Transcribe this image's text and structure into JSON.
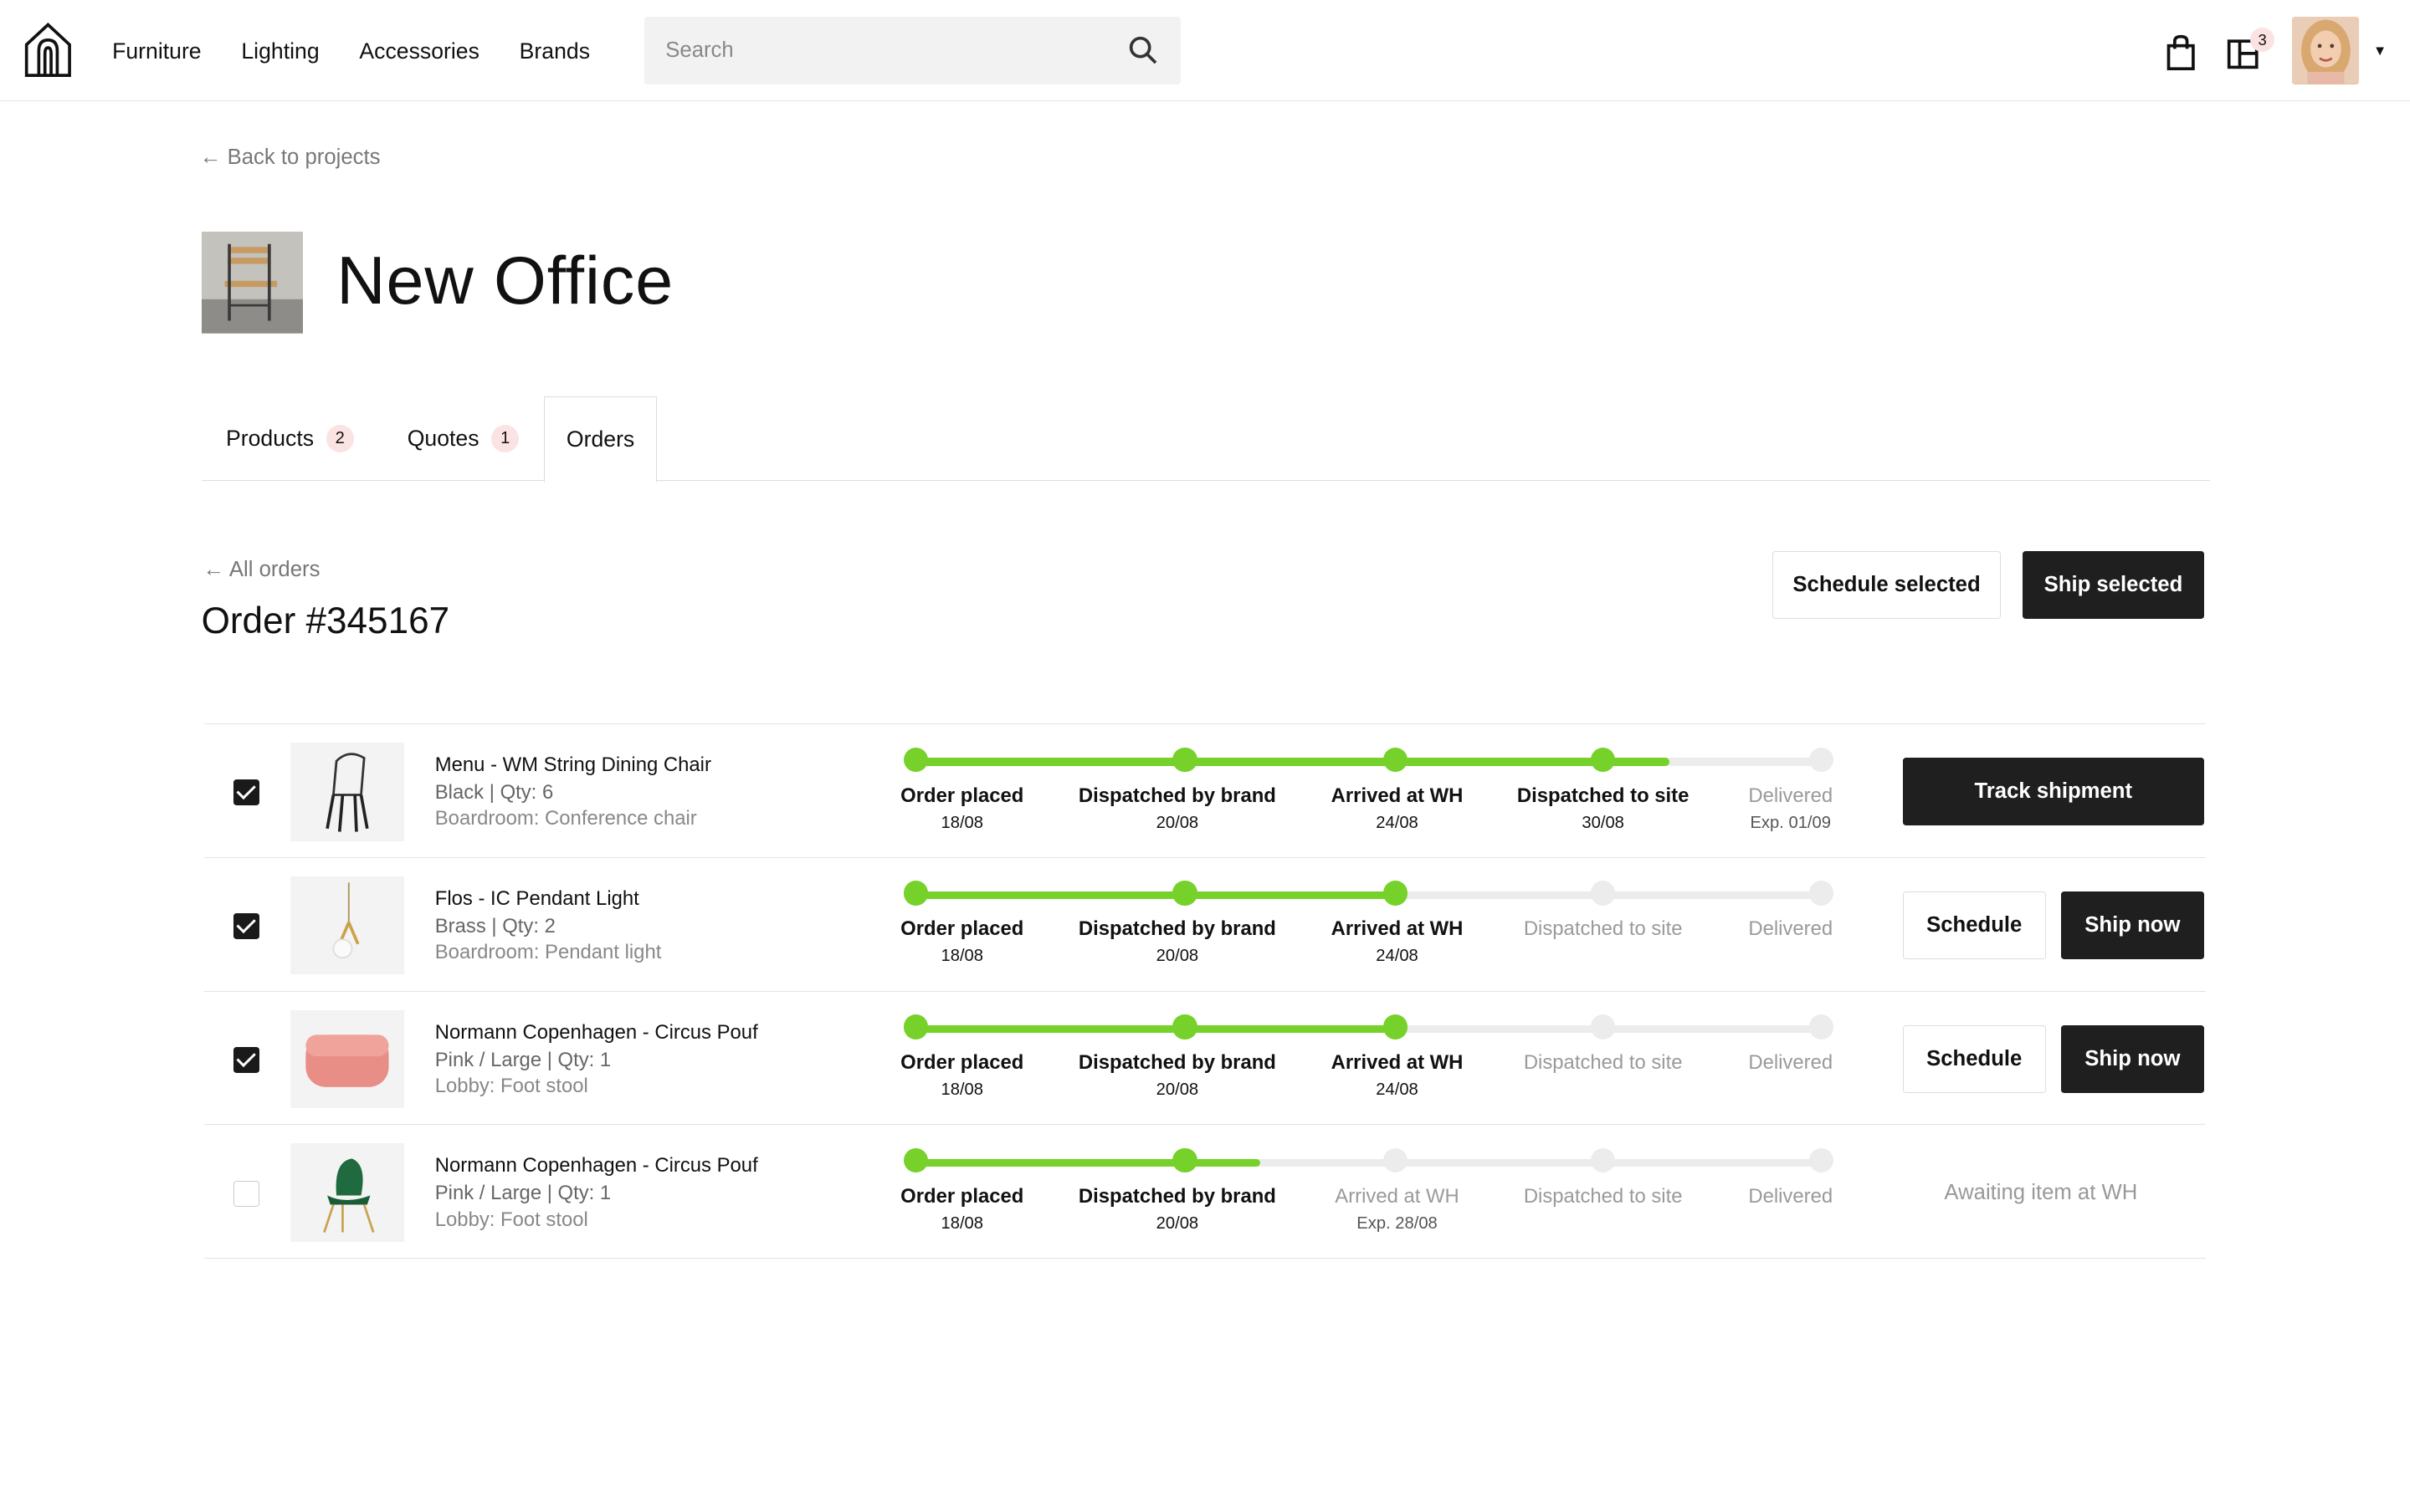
{
  "header": {
    "nav": [
      "Furniture",
      "Lighting",
      "Accessories",
      "Brands"
    ],
    "search_placeholder": "Search",
    "projects_count": "3"
  },
  "page": {
    "back_label": "← Back to projects",
    "project_title": "New Office",
    "tabs": [
      {
        "label": "Products",
        "count": "2"
      },
      {
        "label": "Quotes",
        "count": "1"
      },
      {
        "label": "Orders"
      }
    ]
  },
  "order": {
    "all_orders_label": "← All orders",
    "title": "Order #345167",
    "schedule_selected": "Schedule selected",
    "ship_selected": "Ship selected",
    "steps": [
      "Order placed",
      "Dispatched by brand",
      "Arrived at WH",
      "Dispatched to site",
      "Delivered"
    ],
    "rows": [
      {
        "checked": true,
        "name": "Menu - WM String Dining Chair",
        "variant": "Black  |  Qty: 6",
        "room": "Boardroom: Conference chair",
        "done": 4,
        "progress": 0.83,
        "dates": [
          "18/08",
          "20/08",
          "24/08",
          "30/08",
          "Exp. 01/09"
        ],
        "actions": [
          "Track shipment"
        ]
      },
      {
        "checked": true,
        "name": "Flos - IC Pendant Light",
        "variant": "Brass  |  Qty: 2",
        "room": "Boardroom: Pendant light",
        "done": 3,
        "progress": 0.54,
        "dates": [
          "18/08",
          "20/08",
          "24/08",
          "",
          ""
        ],
        "actions": [
          "Schedule",
          "Ship now"
        ]
      },
      {
        "checked": true,
        "name": "Normann Copenhagen - Circus Pouf",
        "variant": "Pink / Large  |  Qty: 1",
        "room": "Lobby: Foot stool",
        "done": 3,
        "progress": 0.54,
        "dates": [
          "18/08",
          "20/08",
          "24/08",
          "",
          ""
        ],
        "actions": [
          "Schedule",
          "Ship now"
        ]
      },
      {
        "checked": false,
        "name": "Normann Copenhagen - Circus Pouf",
        "variant": "Pink / Large  |  Qty: 1",
        "room": "Lobby: Foot stool",
        "done": 2,
        "progress": 0.38,
        "dates": [
          "18/08",
          "20/08",
          "Exp. 28/08",
          "",
          ""
        ],
        "status_text": "Awaiting item at WH"
      }
    ]
  },
  "colors": {
    "progress_green": "#76d12a",
    "button_dark": "#1f1f1f",
    "badge_pink": "#fbe3e3"
  }
}
